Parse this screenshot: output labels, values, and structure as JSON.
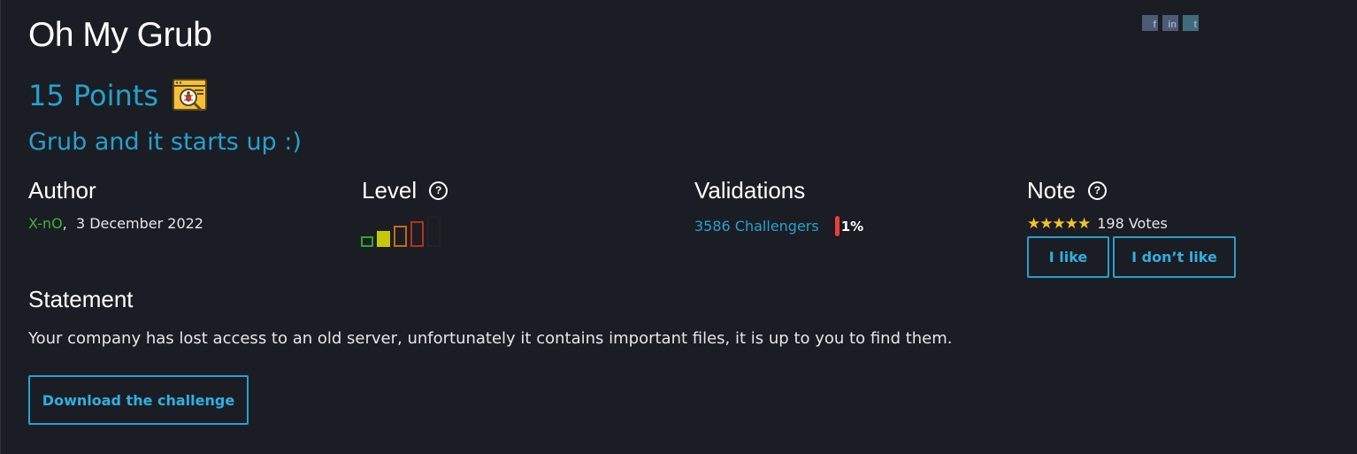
{
  "challenge": {
    "title": "Oh My Grub",
    "points": "15 Points",
    "category_icon": "forensic-bug-icon",
    "subtitle": "Grub and it starts up :)"
  },
  "social": {
    "facebook": "f",
    "linkedin": "in",
    "twitter": "t"
  },
  "author": {
    "heading": "Author",
    "name": "X-nO",
    "separator": ",",
    "date": "3 December 2022"
  },
  "level": {
    "heading": "Level",
    "help": "?",
    "current": 2,
    "max": 5,
    "colors": [
      "#2ea52e",
      "#c7c70a",
      "#c26a1a",
      "#b5301f",
      "#222222"
    ]
  },
  "validations": {
    "heading": "Validations",
    "challengers": "3586 Challengers",
    "percent": "1%",
    "percent_value": 1
  },
  "note": {
    "heading": "Note",
    "help": "?",
    "stars": "★★★★★",
    "rating": 5,
    "votes": "198 Votes",
    "like_label": "I like",
    "dislike_label": "I don’t like"
  },
  "statement": {
    "heading": "Statement",
    "text": "Your company has lost access to an old server, unfortunately it contains important files, it is up to you to find them."
  },
  "download": {
    "label": "Download the challenge"
  },
  "colors": {
    "background": "#1b1d24",
    "accent": "#27a1cc",
    "author": "#3ab33a",
    "stars": "#f3c327",
    "danger": "#f03c3c"
  }
}
